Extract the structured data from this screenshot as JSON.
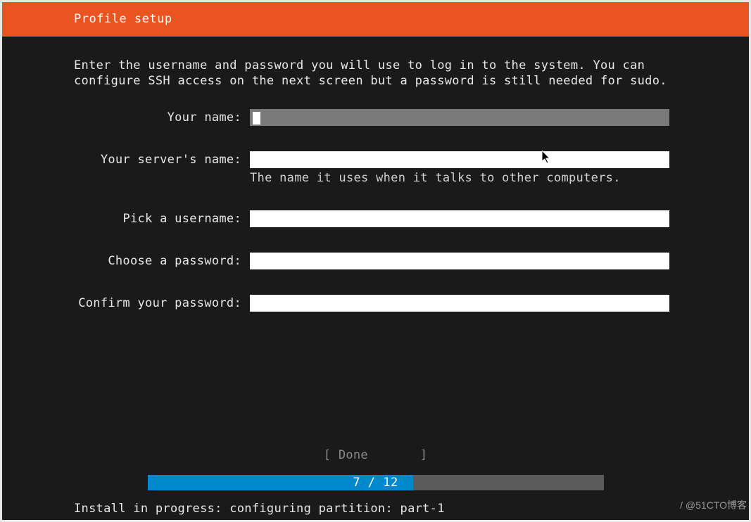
{
  "header": {
    "title": "Profile setup"
  },
  "instructions": "Enter the username and password you will use to log in to the system. You can configure SSH access on the next screen but a password is still needed for sudo.",
  "form": {
    "name": {
      "label": "Your name:",
      "value": ""
    },
    "servername": {
      "label": "Your server's name:",
      "value": "",
      "hint": "The name it uses when it talks to other computers."
    },
    "username": {
      "label": "Pick a username:",
      "value": ""
    },
    "password": {
      "label": "Choose a password:",
      "value": ""
    },
    "confirm": {
      "label": "Confirm your password:",
      "value": ""
    }
  },
  "buttons": {
    "done": "[ Done       ]"
  },
  "progress": {
    "current": 7,
    "total": 12,
    "text": "7 / 12",
    "percent": 58.3
  },
  "status": "Install in progress: configuring partition: part-1",
  "watermark": "/ @51CTO博客"
}
